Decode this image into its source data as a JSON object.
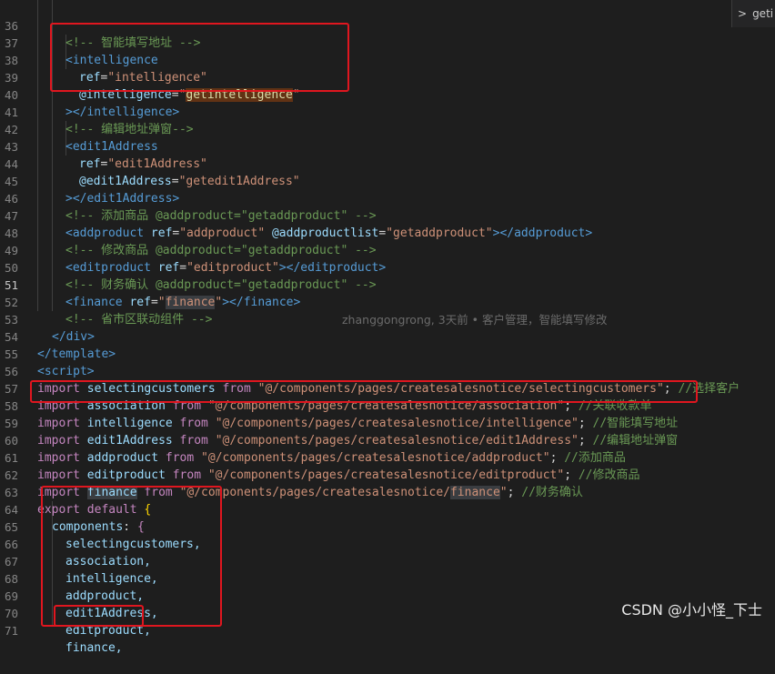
{
  "breadcrumb": {
    "chevron": ">",
    "label": "geti"
  },
  "blame": "zhanggongrong, 3天前 • 客户管理，智能填写修改",
  "watermark": "CSDN @小小怪_下士",
  "lines": [
    {
      "n": "36",
      "t": "<!-- 智能填写地址 -->"
    },
    {
      "n": "37",
      "t": "<intelligence"
    },
    {
      "n": "38",
      "t": "ref=\"intelligence\""
    },
    {
      "n": "39",
      "t": "@intelligence=\"getintelligence\""
    },
    {
      "n": "40",
      "t": "></intelligence>"
    },
    {
      "n": "41",
      "t": "<!-- 编辑地址弹窗-->"
    },
    {
      "n": "42",
      "t": "<edit1Address"
    },
    {
      "n": "43",
      "t": "ref=\"edit1Address\""
    },
    {
      "n": "44",
      "t": "@edit1Address=\"getedit1Address\""
    },
    {
      "n": "45",
      "t": "></edit1Address>"
    },
    {
      "n": "46",
      "t": "<!-- 添加商品 @addproduct=\"getaddproduct\" -->"
    },
    {
      "n": "47",
      "t": "<addproduct ref=\"addproduct\" @addproductlist=\"getaddproduct\"></addproduct>"
    },
    {
      "n": "48",
      "t": "<!-- 修改商品 @addproduct=\"getaddproduct\" -->"
    },
    {
      "n": "49",
      "t": "<editproduct ref=\"editproduct\"></editproduct>"
    },
    {
      "n": "50",
      "t": "<!-- 财务确认 @addproduct=\"getaddproduct\" -->"
    },
    {
      "n": "51",
      "t": "<finance ref=\"finance\"></finance>"
    },
    {
      "n": "52",
      "t": "<!-- 省市区联动组件 -->"
    },
    {
      "n": "53",
      "t": "</div>"
    },
    {
      "n": "54",
      "t": "</template>"
    },
    {
      "n": "55",
      "t": "<script>"
    },
    {
      "n": "56",
      "t": "import selectingcustomers from \"@/components/pages/createsalesnotice/selectingcustomers\"; //选择客户"
    },
    {
      "n": "57",
      "t": "import association from \"@/components/pages/createsalesnotice/association\"; //关联收款单"
    },
    {
      "n": "58",
      "t": "import intelligence from \"@/components/pages/createsalesnotice/intelligence\"; //智能填写地址"
    },
    {
      "n": "59",
      "t": "import edit1Address from \"@/components/pages/createsalesnotice/edit1Address\"; //编辑地址弹窗"
    },
    {
      "n": "60",
      "t": "import addproduct from \"@/components/pages/createsalesnotice/addproduct\"; //添加商品"
    },
    {
      "n": "61",
      "t": "import editproduct from \"@/components/pages/createsalesnotice/editproduct\"; //修改商品"
    },
    {
      "n": "62",
      "t": "import finance from \"@/components/pages/createsalesnotice/finance\"; //财务确认"
    },
    {
      "n": "63",
      "t": "export default {"
    },
    {
      "n": "64",
      "t": "components: {"
    },
    {
      "n": "65",
      "t": "selectingcustomers,"
    },
    {
      "n": "66",
      "t": "association,"
    },
    {
      "n": "67",
      "t": "intelligence,"
    },
    {
      "n": "68",
      "t": "addproduct,"
    },
    {
      "n": "69",
      "t": "edit1Address,"
    },
    {
      "n": "70",
      "t": "editproduct,"
    },
    {
      "n": "71",
      "t": "finance,"
    }
  ],
  "colors": {
    "background": "#1e1e1e",
    "highlight_box": "#e0161f",
    "tag": "#569cd6",
    "attribute": "#9cdcfe",
    "string": "#ce9178",
    "comment": "#6a9955",
    "keyword": "#c586c0"
  }
}
